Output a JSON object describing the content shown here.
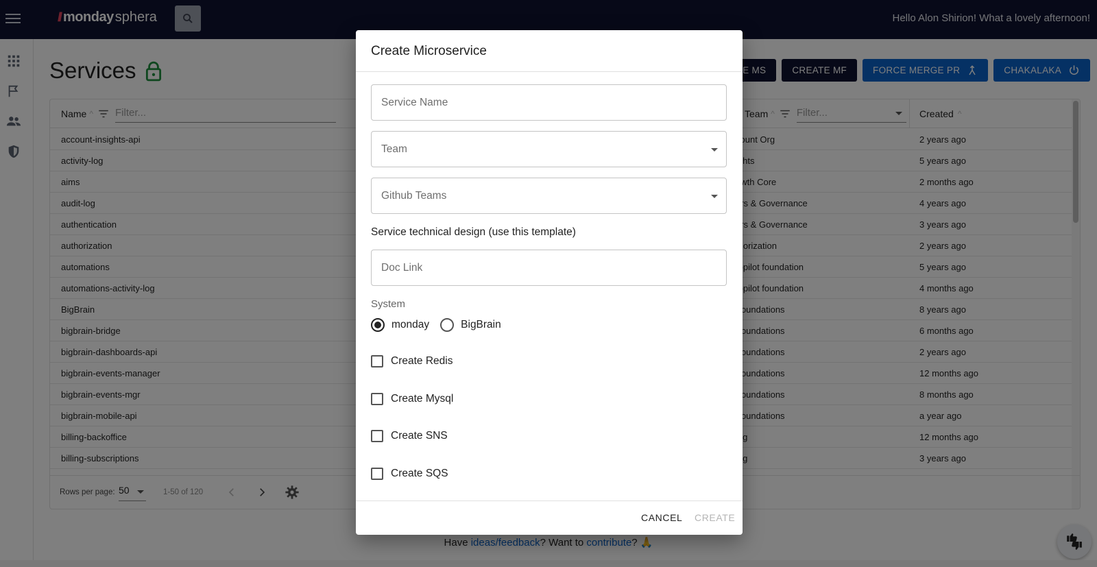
{
  "header": {
    "brand": "monday",
    "brand_suffix": "sphera",
    "greeting": "Hello Alon Shirion! What a lovely afternoon!"
  },
  "page": {
    "title": "Services"
  },
  "actions": {
    "create_ms": "CREATE MS",
    "create_mf": "CREATE MF",
    "force_merge": "FORCE MERGE PR",
    "chakalaka": "CHAKALAKA"
  },
  "table": {
    "headers": {
      "name": "Name",
      "team": "Team",
      "created": "Created"
    },
    "filter_placeholder": "Filter...",
    "rows": [
      {
        "name": "account-insights-api",
        "team": "count Org",
        "created": "2 years ago"
      },
      {
        "name": "activity-log",
        "team": "ights",
        "created": "5 years ago"
      },
      {
        "name": "aims",
        "team": "owth Core",
        "created": "2 months ago"
      },
      {
        "name": "audit-log",
        "team": "ers & Governance",
        "created": "4 years ago"
      },
      {
        "name": "authentication",
        "team": "ers & Governance",
        "created": "3 years ago"
      },
      {
        "name": "authorization",
        "team": "thorization",
        "created": "2 years ago"
      },
      {
        "name": "automations",
        "team": "topilot foundation",
        "created": "5 years ago"
      },
      {
        "name": "automations-activity-log",
        "team": "topilot foundation",
        "created": "4 months ago"
      },
      {
        "name": "BigBrain",
        "team": "Foundations",
        "created": "8 years ago"
      },
      {
        "name": "bigbrain-bridge",
        "team": "Foundations",
        "created": "6 months ago"
      },
      {
        "name": "bigbrain-dashboards-api",
        "team": "Foundations",
        "created": "2 years ago"
      },
      {
        "name": "bigbrain-events-manager",
        "team": "Foundations",
        "created": "12 months ago"
      },
      {
        "name": "bigbrain-events-mgr",
        "team": "Foundations",
        "created": "8 months ago"
      },
      {
        "name": "bigbrain-mobile-api",
        "team": "Foundations",
        "created": "a year ago"
      },
      {
        "name": "billing-backoffice",
        "team": "ing",
        "created": "12 months ago"
      },
      {
        "name": "billing-subscriptions",
        "team": "ing",
        "created": "3 years ago"
      }
    ],
    "footer": {
      "rows_per_page_label": "Rows per page:",
      "rows_per_page": "50",
      "range": "1-50 of 120"
    }
  },
  "footer": {
    "prefix": "Have ",
    "link1": "ideas/feedback",
    "middle": "? Want to ",
    "link2": "contribute",
    "suffix": "? 🙏"
  },
  "modal": {
    "title": "Create Microservice",
    "service_name_placeholder": "Service Name",
    "team_label": "Team",
    "github_teams_label": "Github Teams",
    "design_label": "Service technical design (use this template)",
    "doc_link_placeholder": "Doc Link",
    "system_label": "System",
    "system_options": [
      "monday",
      "BigBrain"
    ],
    "system_selected": "monday",
    "checkboxes": [
      "Create Redis",
      "Create Mysql",
      "Create SNS",
      "Create SQS"
    ],
    "cancel": "CANCEL",
    "create": "CREATE"
  },
  "colors": {
    "topbar": "#0f1330",
    "accent_blue": "#0a63c9",
    "lock_green": "#1e8e3e"
  }
}
